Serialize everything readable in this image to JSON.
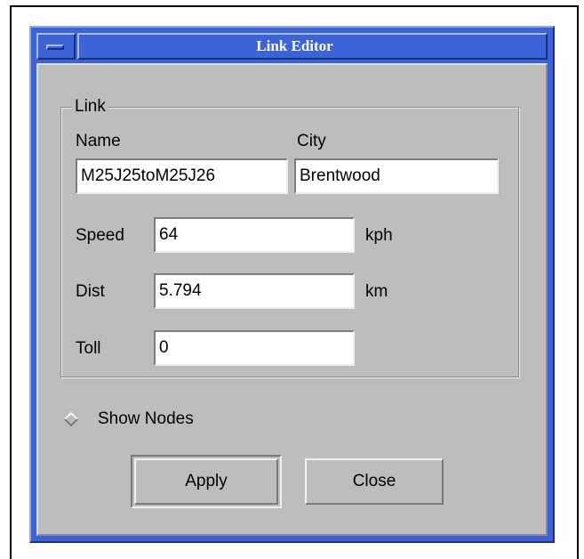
{
  "window": {
    "title": "Link Editor"
  },
  "link_group": {
    "legend": "Link",
    "name_label": "Name",
    "city_label": "City",
    "name_value": "M25J25toM25J26",
    "city_value": "Brentwood",
    "speed_label": "Speed",
    "speed_value": "64",
    "speed_unit": "kph",
    "dist_label": "Dist",
    "dist_value": "5.794",
    "dist_unit": "km",
    "toll_label": "Toll",
    "toll_value": "0"
  },
  "options": {
    "show_nodes_label": "Show Nodes",
    "show_nodes_checked": false
  },
  "buttons": {
    "apply_label": "Apply",
    "close_label": "Close"
  },
  "colors": {
    "titlebar": "#3d63d8",
    "client": "#bdbdbd",
    "field_bg": "#ffffff"
  }
}
